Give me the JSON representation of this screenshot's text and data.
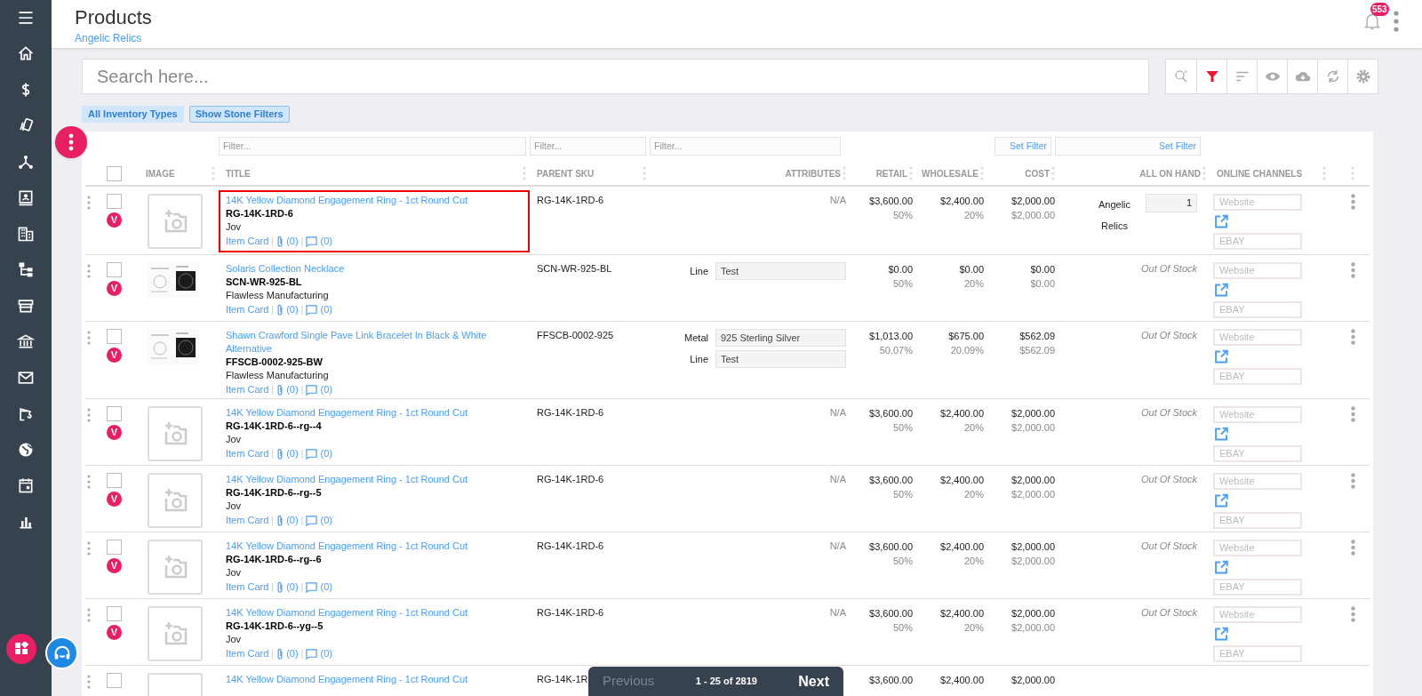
{
  "header": {
    "title": "Products",
    "subtitle": "Angelic Relics",
    "notifications": "553"
  },
  "search": {
    "placeholder": "Search here..."
  },
  "toolbar": [
    {
      "kind": "search",
      "active": false
    },
    {
      "kind": "filter",
      "active": true
    },
    {
      "kind": "sort",
      "active": false
    },
    {
      "kind": "view",
      "active": false
    },
    {
      "kind": "download",
      "active": false
    },
    {
      "kind": "sync",
      "active": false
    },
    {
      "kind": "settings",
      "active": false
    }
  ],
  "chips": [
    {
      "label": "All Inventory Types",
      "selected": false
    },
    {
      "label": "Show Stone Filters",
      "selected": true
    }
  ],
  "filters": {
    "title": "Filter...",
    "parent_sku": "Filter...",
    "attributes": "Filter...",
    "cost": "Set Filter",
    "on_hand": "Set Filter"
  },
  "select_all": {
    "checked": false
  },
  "columns": {
    "image": "IMAGE",
    "title": "TITLE",
    "parent_sku": "PARENT SKU",
    "attributes": "ATTRIBUTES",
    "retail": "RETAIL",
    "wholesale": "WHOLESALE",
    "cost": "COST",
    "on_hand": "ALL ON HAND",
    "online": "ONLINE CHANNELS"
  },
  "rows": [
    {
      "kind": "placeholder",
      "highlighted": true,
      "checked": false,
      "badge": "V",
      "title": "14K Yellow Diamond Engagement Ring - 1ct Round Cut",
      "sku": "RG-14K-1RD-6",
      "vendor": "Jov",
      "links": [
        "Item Card",
        "|",
        "(0)",
        "|",
        "(0)"
      ],
      "parent_sku": "RG-14K-1RD-6",
      "attributes_text": "N/A",
      "retail": "$3,600.00",
      "retail_pct": "50%",
      "wholesale": "$2,400.00",
      "wholesale_pct": "20%",
      "cost": "$2,000.00",
      "cost_2": "$2,000.00",
      "on_hand": {
        "location": "Angelic Relics",
        "qty": "1"
      },
      "channels": [
        "Website",
        "EBAY"
      ]
    },
    {
      "kind": "picture",
      "checked": false,
      "badge": "V",
      "title": "Solaris Collection Necklace",
      "sku": "SCN-WR-925-BL",
      "vendor": "Flawless Manufacturing",
      "links": [
        "Item Card",
        "|",
        "(0)",
        "|",
        "(0)"
      ],
      "parent_sku": "SCN-WR-925-BL",
      "attributes": [
        {
          "label": "Line",
          "value": "Test"
        }
      ],
      "retail": "$0.00",
      "retail_pct": "50%",
      "wholesale": "$0.00",
      "wholesale_pct": "20%",
      "cost": "$0.00",
      "cost_2": "$0.00",
      "stock": "Out Of Stock",
      "channels": [
        "Website",
        "EBAY"
      ]
    },
    {
      "kind": "picture",
      "checked": false,
      "badge": "V",
      "title": "Shawn Crawford Single Pave Link Bracelet In Black & White Alternative",
      "sku": "FFSCB-0002-925-BW",
      "vendor": "Flawless Manufacturing",
      "links": [
        "Item Card",
        "|",
        "(0)",
        "|",
        "(0)"
      ],
      "parent_sku": "FFSCB-0002-925",
      "attributes": [
        {
          "label": "Metal",
          "value": "925 Sterling Silver"
        },
        {
          "label": "Line",
          "value": "Test"
        }
      ],
      "retail": "$1,013.00",
      "retail_pct": "50.07%",
      "wholesale": "$675.00",
      "wholesale_pct": "20.09%",
      "cost": "$562.09",
      "cost_2": "$562.09",
      "stock": "Out Of Stock",
      "channels": [
        "Website",
        "EBAY"
      ]
    },
    {
      "kind": "placeholder",
      "checked": false,
      "badge": "V",
      "title": "14K Yellow Diamond Engagement Ring - 1ct Round Cut",
      "sku": "RG-14K-1RD-6--rg--4",
      "vendor": "Jov",
      "links": [
        "Item Card",
        "|",
        "(0)",
        "|",
        "(0)"
      ],
      "parent_sku": "RG-14K-1RD-6",
      "attributes_text": "N/A",
      "retail": "$3,600.00",
      "retail_pct": "50%",
      "wholesale": "$2,400.00",
      "wholesale_pct": "20%",
      "cost": "$2,000.00",
      "cost_2": "$2,000.00",
      "stock": "Out Of Stock",
      "channels": [
        "Website",
        "EBAY"
      ]
    },
    {
      "kind": "placeholder",
      "checked": false,
      "badge": "V",
      "title": "14K Yellow Diamond Engagement Ring - 1ct Round Cut",
      "sku": "RG-14K-1RD-6--rg--5",
      "vendor": "Jov",
      "links": [
        "Item Card",
        "|",
        "(0)",
        "|",
        "(0)"
      ],
      "parent_sku": "RG-14K-1RD-6",
      "attributes_text": "N/A",
      "retail": "$3,600.00",
      "retail_pct": "50%",
      "wholesale": "$2,400.00",
      "wholesale_pct": "20%",
      "cost": "$2,000.00",
      "cost_2": "$2,000.00",
      "stock": "Out Of Stock",
      "channels": [
        "Website",
        "EBAY"
      ]
    },
    {
      "kind": "placeholder",
      "checked": false,
      "badge": "V",
      "title": "14K Yellow Diamond Engagement Ring - 1ct Round Cut",
      "sku": "RG-14K-1RD-6--rg--6",
      "vendor": "Jov",
      "links": [
        "Item Card",
        "|",
        "(0)",
        "|",
        "(0)"
      ],
      "parent_sku": "RG-14K-1RD-6",
      "attributes_text": "N/A",
      "retail": "$3,600.00",
      "retail_pct": "50%",
      "wholesale": "$2,400.00",
      "wholesale_pct": "20%",
      "cost": "$2,000.00",
      "cost_2": "$2,000.00",
      "stock": "Out Of Stock",
      "channels": [
        "Website",
        "EBAY"
      ]
    },
    {
      "kind": "placeholder",
      "checked": false,
      "badge": "V",
      "title": "14K Yellow Diamond Engagement Ring - 1ct Round Cut",
      "sku": "RG-14K-1RD-6--yg--5",
      "vendor": "Jov",
      "links": [
        "Item Card",
        "|",
        "(0)",
        "|",
        "(0)"
      ],
      "parent_sku": "RG-14K-1RD-6",
      "attributes_text": "N/A",
      "retail": "$3,600.00",
      "retail_pct": "50%",
      "wholesale": "$2,400.00",
      "wholesale_pct": "20%",
      "cost": "$2,000.00",
      "cost_2": "$2,000.00",
      "stock": "Out Of Stock",
      "channels": [
        "Website",
        "EBAY"
      ]
    },
    {
      "kind": "placeholder",
      "checked": false,
      "title": "14K Yellow Diamond Engagement Ring - 1ct Round Cut",
      "parent_sku": "RG-14K-1R",
      "retail": "$3,600.00",
      "wholesale": "$2,400.00",
      "cost": "$2,000.00"
    }
  ],
  "pager": {
    "previous": "Previous",
    "previous_disabled": true,
    "range": "1 - 25 of 2819",
    "next": "Next"
  }
}
